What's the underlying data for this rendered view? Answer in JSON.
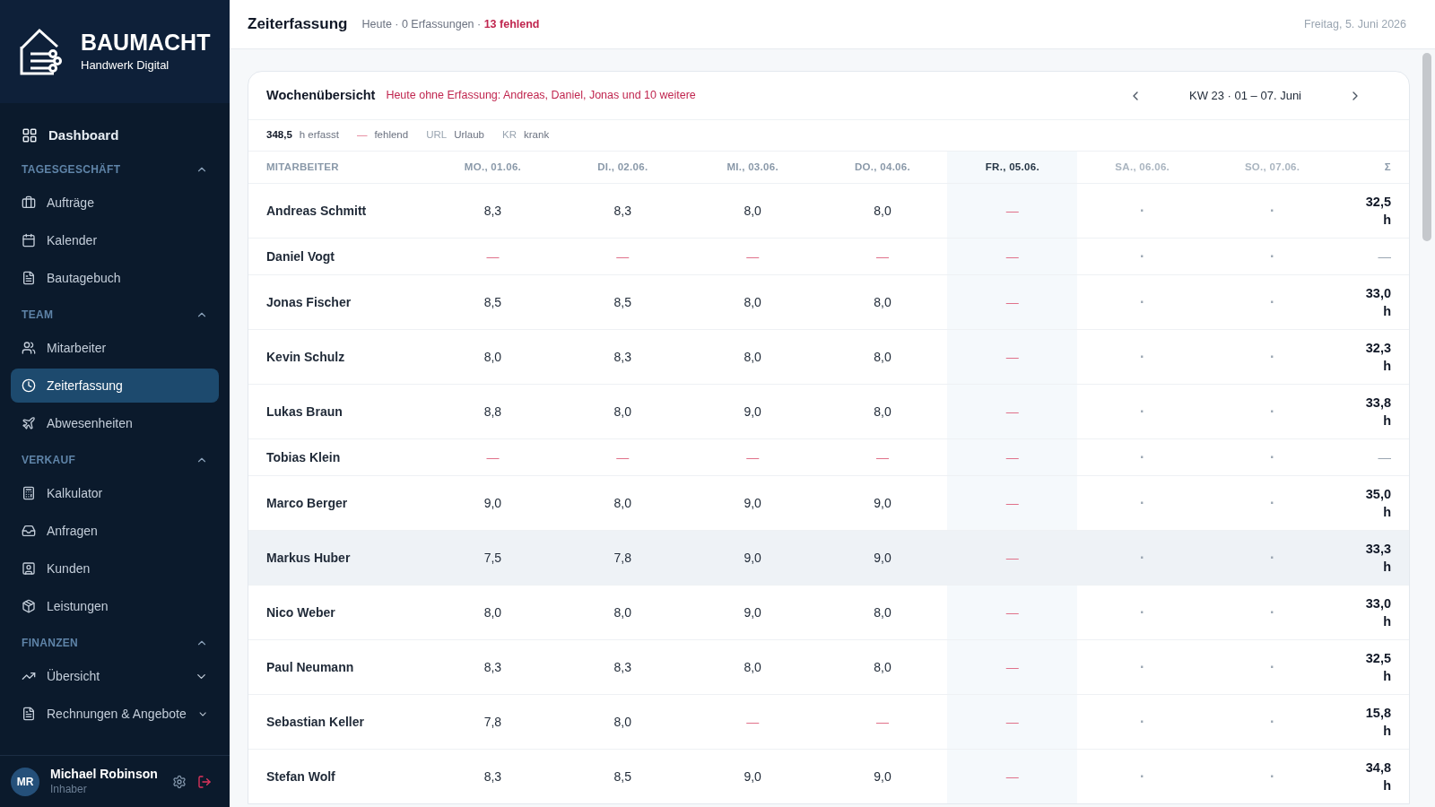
{
  "brand": {
    "name": "BAUMACHT",
    "tagline": "Handwerk Digital"
  },
  "sidebar": {
    "top_item": {
      "label": "Dashboard",
      "selected": false
    },
    "sections": [
      {
        "title": "TAGESGESCHÄFT",
        "expanded": true,
        "items": [
          {
            "label": "Aufträge",
            "selected": false,
            "expandable": false
          },
          {
            "label": "Kalender",
            "selected": false,
            "expandable": false
          },
          {
            "label": "Bautagebuch",
            "selected": false,
            "expandable": false
          }
        ]
      },
      {
        "title": "TEAM",
        "expanded": true,
        "items": [
          {
            "label": "Mitarbeiter",
            "selected": false,
            "expandable": false
          },
          {
            "label": "Zeiterfassung",
            "selected": true,
            "expandable": false
          },
          {
            "label": "Abwesenheiten",
            "selected": false,
            "expandable": false
          }
        ]
      },
      {
        "title": "VERKAUF",
        "expanded": true,
        "items": [
          {
            "label": "Kalkulator",
            "selected": false,
            "expandable": false
          },
          {
            "label": "Anfragen",
            "selected": false,
            "expandable": false
          },
          {
            "label": "Kunden",
            "selected": false,
            "expandable": false
          },
          {
            "label": "Leistungen",
            "selected": false,
            "expandable": false
          }
        ]
      },
      {
        "title": "FINANZEN",
        "expanded": true,
        "items": [
          {
            "label": "Übersicht",
            "selected": false,
            "expandable": true
          },
          {
            "label": "Rechnungen & Angebote",
            "selected": false,
            "expandable": true
          }
        ]
      }
    ],
    "user": {
      "initials": "MR",
      "name": "Michael Robinson",
      "role": "Inhaber"
    }
  },
  "header": {
    "title": "Zeiterfassung",
    "summary": "Heute · 0 Erfassungen · ",
    "missing": "13 fehlend",
    "date": "Freitag, 5. Juni 2026"
  },
  "card": {
    "title": "Wochenübersicht",
    "alert": "Heute ohne Erfassung: Andreas, Daniel, Jonas und 10 weitere",
    "week": "KW 23 · 01 – 07. Juni",
    "legend": {
      "total": "348,5",
      "total_label": "h erfasst",
      "missing_mark": "—",
      "missing_label": "fehlend",
      "vacation_code": "URL",
      "vacation_label": "Urlaub",
      "sick_code": "KR",
      "sick_label": "krank"
    }
  },
  "table": {
    "columns": [
      {
        "label": "MITARBEITER",
        "kind": "name"
      },
      {
        "label": "MO., 01.06.",
        "kind": "day"
      },
      {
        "label": "DI., 02.06.",
        "kind": "day"
      },
      {
        "label": "MI., 03.06.",
        "kind": "day"
      },
      {
        "label": "DO., 04.06.",
        "kind": "day"
      },
      {
        "label": "FR., 05.06.",
        "kind": "today"
      },
      {
        "label": "SA., 06.06.",
        "kind": "weekend"
      },
      {
        "label": "SO., 07.06.",
        "kind": "weekend"
      },
      {
        "label": "Σ",
        "kind": "sum"
      }
    ],
    "rows": [
      {
        "highlighted": false,
        "cells": [
          "Andreas Schmitt",
          "8,3",
          "8,3",
          "8,0",
          "8,0",
          "—",
          "·",
          "·",
          "32,5 h"
        ]
      },
      {
        "highlighted": false,
        "cells": [
          "Daniel Vogt",
          "—",
          "—",
          "—",
          "—",
          "—",
          "·",
          "·",
          "—"
        ]
      },
      {
        "highlighted": false,
        "cells": [
          "Jonas Fischer",
          "8,5",
          "8,5",
          "8,0",
          "8,0",
          "—",
          "·",
          "·",
          "33,0 h"
        ]
      },
      {
        "highlighted": false,
        "cells": [
          "Kevin Schulz",
          "8,0",
          "8,3",
          "8,0",
          "8,0",
          "—",
          "·",
          "·",
          "32,3 h"
        ]
      },
      {
        "highlighted": false,
        "cells": [
          "Lukas Braun",
          "8,8",
          "8,0",
          "9,0",
          "8,0",
          "—",
          "·",
          "·",
          "33,8 h"
        ]
      },
      {
        "highlighted": false,
        "cells": [
          "Tobias Klein",
          "—",
          "—",
          "—",
          "—",
          "—",
          "·",
          "·",
          "—"
        ]
      },
      {
        "highlighted": false,
        "cells": [
          "Marco Berger",
          "9,0",
          "8,0",
          "9,0",
          "9,0",
          "—",
          "·",
          "·",
          "35,0 h"
        ]
      },
      {
        "highlighted": true,
        "cells": [
          "Markus Huber",
          "7,5",
          "7,8",
          "9,0",
          "9,0",
          "—",
          "·",
          "·",
          "33,3 h"
        ]
      },
      {
        "highlighted": false,
        "cells": [
          "Nico Weber",
          "8,0",
          "8,0",
          "9,0",
          "8,0",
          "—",
          "·",
          "·",
          "33,0 h"
        ]
      },
      {
        "highlighted": false,
        "cells": [
          "Paul Neumann",
          "8,3",
          "8,3",
          "8,0",
          "8,0",
          "—",
          "·",
          "·",
          "32,5 h"
        ]
      },
      {
        "highlighted": false,
        "cells": [
          "Sebastian Keller",
          "7,8",
          "8,0",
          "—",
          "—",
          "—",
          "·",
          "·",
          "15,8 h"
        ]
      },
      {
        "highlighted": false,
        "cells": [
          "Stefan Wolf",
          "8,3",
          "8,5",
          "9,0",
          "9,0",
          "—",
          "·",
          "·",
          "34,8 h"
        ]
      }
    ]
  }
}
